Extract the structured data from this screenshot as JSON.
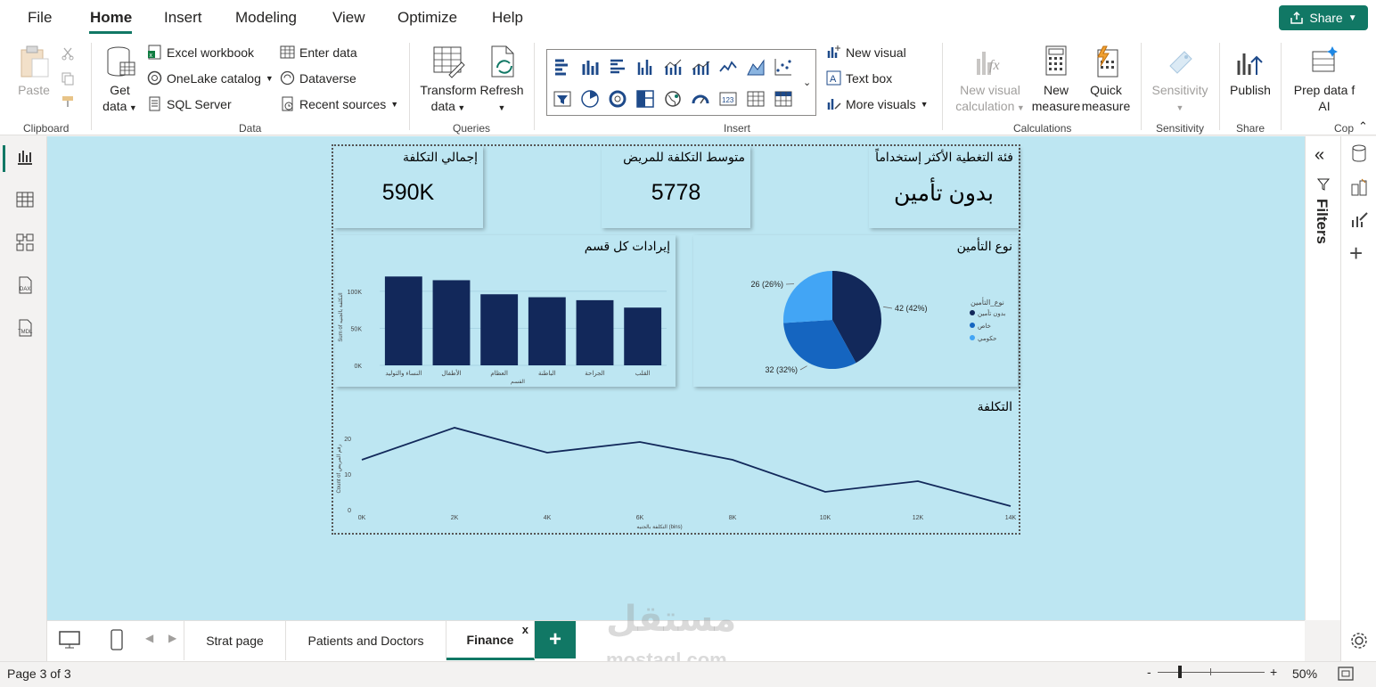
{
  "menu": {
    "tabs": [
      "File",
      "Home",
      "Insert",
      "Modeling",
      "View",
      "Optimize",
      "Help"
    ],
    "active": "Home",
    "share_label": "Share"
  },
  "ribbon": {
    "clipboard": {
      "paste": "Paste",
      "label": "Clipboard"
    },
    "data": {
      "get_data": "Get",
      "get_data2": "data",
      "excel": "Excel workbook",
      "onelake": "OneLake catalog",
      "sql": "SQL Server",
      "enter_data": "Enter data",
      "dataverse": "Dataverse",
      "recent": "Recent sources",
      "label": "Data"
    },
    "queries": {
      "transform": "Transform",
      "transform2": "data",
      "refresh": "Refresh",
      "label": "Queries"
    },
    "insert": {
      "new_visual": "New visual",
      "text_box": "Text box",
      "more_visuals": "More visuals",
      "label": "Insert"
    },
    "calculations": {
      "new_visual_calc": "New visual",
      "new_visual_calc2": "calculation",
      "new_measure": "New",
      "new_measure2": "measure",
      "quick_measure": "Quick",
      "quick_measure2": "measure",
      "label": "Calculations"
    },
    "sensitivity": {
      "button": "Sensitivity",
      "label": "Sensitivity"
    },
    "share": {
      "publish": "Publish",
      "label": "Share"
    },
    "copilot": {
      "prep": "Prep data f",
      "prep2": "AI",
      "label": "Cop"
    }
  },
  "cards": [
    {
      "title": "إجمالي التكلفة",
      "value": "590K"
    },
    {
      "title": "متوسط التكلفة للمريض",
      "value": "5778"
    },
    {
      "title": "فئة التغطية الأكثر إستخداماً",
      "value": "بدون تأمين"
    }
  ],
  "chart_data": [
    {
      "type": "bar",
      "title": "إيرادات كل قسم",
      "categories": [
        "النساء والتوليد",
        "الأطفال",
        "العظام",
        "الباطنة",
        "الجراحة",
        "القلب"
      ],
      "values": [
        120000,
        115000,
        96000,
        92000,
        88000,
        78000
      ],
      "ylim": [
        0,
        130000
      ],
      "yticks": [
        "0K",
        "50K",
        "100K"
      ],
      "ytick_values": [
        0,
        50000,
        100000
      ],
      "xlabel": "القسم",
      "ylabel": "Sum of التكلفة بالجنيه",
      "color": "#12285a"
    },
    {
      "type": "pie",
      "title": "نوع التأمين",
      "legend_title": "نوع_التأمين",
      "legend_position": "right",
      "slices": [
        {
          "name": "بدون تأمين",
          "value": 42,
          "label": "42 (42%)",
          "color": "#12285a"
        },
        {
          "name": "خاص",
          "value": 32,
          "label": "32 (32%)",
          "color": "#1565c0"
        },
        {
          "name": "حكومي",
          "value": 26,
          "label": "26 (26%)",
          "color": "#42a5f5"
        }
      ]
    },
    {
      "type": "line",
      "title": "التكلفة",
      "x": [
        0,
        2000,
        4000,
        6000,
        8000,
        10000,
        12000,
        14000
      ],
      "y": [
        14,
        23,
        16,
        19,
        14,
        5,
        8,
        1
      ],
      "xticks": [
        "0K",
        "2K",
        "4K",
        "6K",
        "8K",
        "10K",
        "12K",
        "14K"
      ],
      "yticks": [
        "0",
        "10",
        "20"
      ],
      "ytick_values": [
        0,
        10,
        20
      ],
      "ylim": [
        0,
        25
      ],
      "xlabel": "التكلفة بالجنيه (bins)",
      "ylabel": "Count of رقم المريض",
      "color": "#12285a"
    }
  ],
  "right_pane": {
    "filters": "Filters"
  },
  "pages": {
    "tabs": [
      "Strat page",
      "Patients and Doctors",
      "Finance"
    ],
    "active": "Finance",
    "close": "x",
    "add": "+"
  },
  "status": {
    "page": "Page 3 of 3",
    "zoom": "50%",
    "minus": "-",
    "plus": "+"
  },
  "watermark": {
    "text": "مستقل",
    "url": "mostaql.com"
  }
}
